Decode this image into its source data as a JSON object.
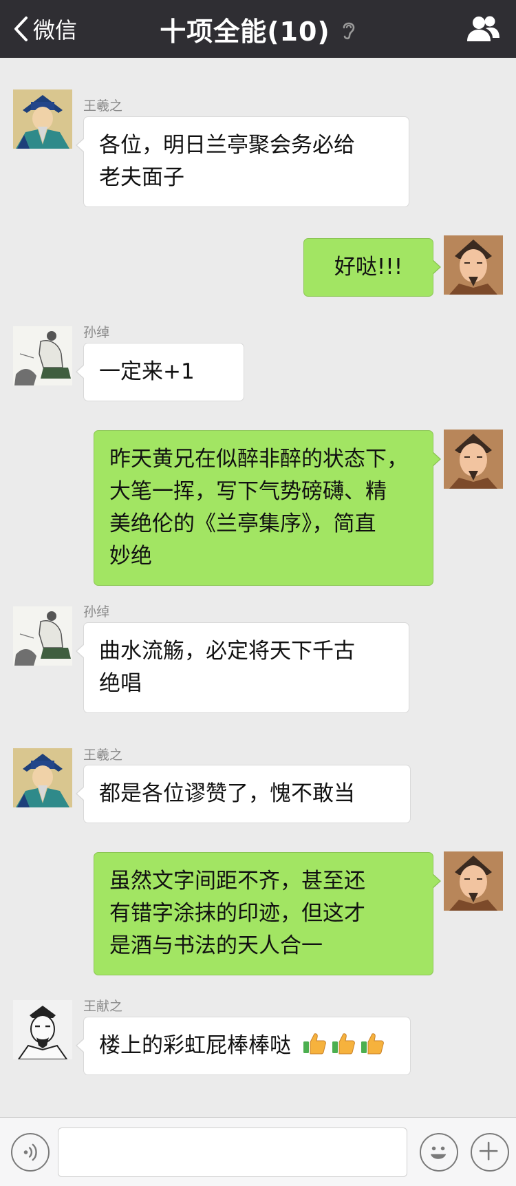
{
  "header": {
    "back_label": "微信",
    "title": "十项全能(10)",
    "icons": {
      "back": "chevron-left-icon",
      "mute": "ear-muted-icon",
      "members": "group-members-icon"
    }
  },
  "messages": [
    {
      "side": "left",
      "sender": "王羲之",
      "avatar": "wang-xizhi-portrait",
      "lines": [
        "各位，明日兰亭聚会务必给",
        "老夫面子"
      ]
    },
    {
      "side": "right",
      "avatar": "self-portrait",
      "lines": [
        "好哒!!!"
      ]
    },
    {
      "side": "left",
      "sender": "孙绰",
      "avatar": "sun-chuo-portrait",
      "lines": [
        "一定来+1"
      ]
    },
    {
      "side": "right",
      "avatar": "self-portrait",
      "lines": [
        "昨天黄兄在似醉非醉的状态下，",
        "大笔一挥，写下气势磅礴、精",
        "美绝伦的《兰亭集序》，简直",
        "妙绝"
      ]
    },
    {
      "side": "left",
      "sender": "孙绰",
      "avatar": "sun-chuo-portrait",
      "lines": [
        "曲水流觞，必定将天下千古",
        "绝唱"
      ]
    },
    {
      "side": "left",
      "sender": "王羲之",
      "avatar": "wang-xizhi-portrait",
      "lines": [
        "都是各位谬赞了，愧不敢当"
      ]
    },
    {
      "side": "right",
      "avatar": "self-portrait",
      "lines": [
        "虽然文字间距不齐，甚至还",
        "有错字涂抹的印迹，但这才",
        "是酒与书法的天人合一"
      ]
    },
    {
      "side": "left",
      "sender": "王献之",
      "avatar": "wang-xianzhi-portrait",
      "lines": [
        "楼上的彩虹屁棒棒哒"
      ],
      "emoji": [
        "thumbs-up-icon",
        "thumbs-up-icon",
        "thumbs-up-icon"
      ]
    }
  ],
  "inputbar": {
    "placeholder": "",
    "icons": {
      "voice": "voice-icon",
      "emoji": "emoji-smile-icon",
      "more": "plus-icon"
    }
  },
  "colors": {
    "header_bg": "#2f2e33",
    "chat_bg": "#ebebeb",
    "bubble_self": "#a2e563",
    "bubble_other": "#ffffff"
  }
}
